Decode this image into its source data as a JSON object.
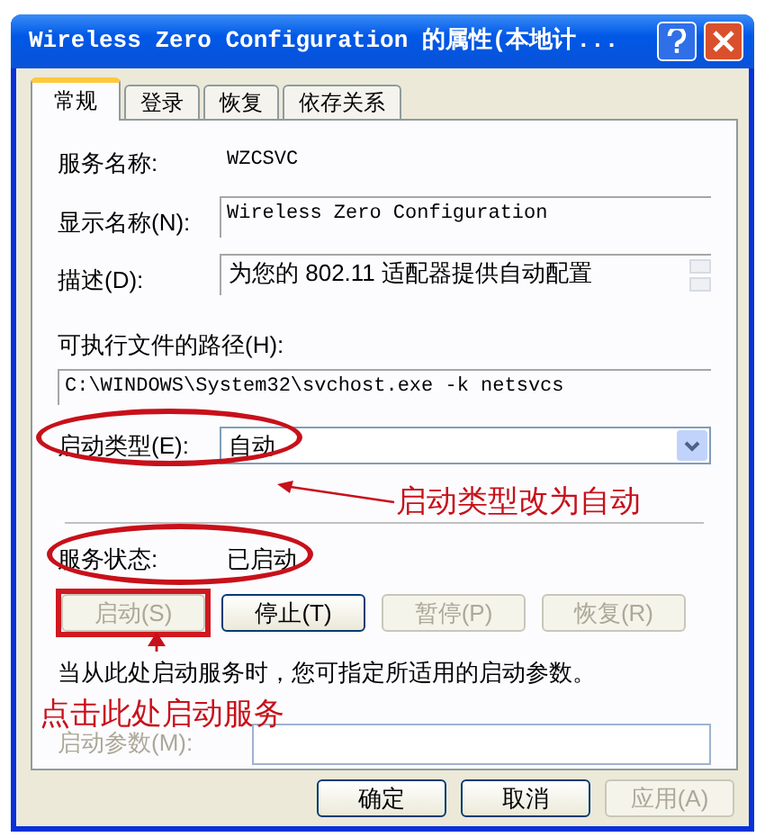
{
  "window": {
    "title": "Wireless Zero Configuration 的属性(本地计..."
  },
  "tabs": [
    {
      "label": "常规",
      "selected": true
    },
    {
      "label": "登录",
      "selected": false
    },
    {
      "label": "恢复",
      "selected": false
    },
    {
      "label": "依存关系",
      "selected": false
    }
  ],
  "fields": [
    {
      "kind": "text",
      "label": "服务名称:",
      "value": "WZCSVC"
    },
    {
      "kind": "box",
      "label": "显示名称(N):",
      "value": "Wireless Zero Configuration"
    },
    {
      "kind": "scrollbox",
      "label": "描述(D):",
      "value": "为您的 802.11 适配器提供自动配置"
    }
  ],
  "path": {
    "label": "可执行文件的路径(H):",
    "value": "C:\\WINDOWS\\System32\\svchost.exe -k netsvcs"
  },
  "startup_type": {
    "label": "启动类型(E):",
    "value": "自动",
    "highlighted": true,
    "note": "启动类型改为自动"
  },
  "service_status": {
    "label": "服务状态:",
    "value": "已启动",
    "highlighted": true
  },
  "service_buttons": [
    {
      "label": "启动(S)",
      "disabled": true,
      "highlighted": true
    },
    {
      "label": "停止(T)",
      "disabled": false,
      "highlighted": false
    },
    {
      "label": "暂停(P)",
      "disabled": true,
      "highlighted": false
    },
    {
      "label": "恢复(R)",
      "disabled": true,
      "highlighted": false
    }
  ],
  "hint": "当从此处启动服务时，您可指定所适用的启动参数。",
  "button_note": "点击此处启动服务",
  "start_params": {
    "label": "启动参数(M):",
    "disabled": true
  },
  "dialog_buttons": [
    {
      "label": "确定",
      "disabled": false
    },
    {
      "label": "取消",
      "disabled": false
    },
    {
      "label": "应用(A)",
      "disabled": true
    }
  ]
}
